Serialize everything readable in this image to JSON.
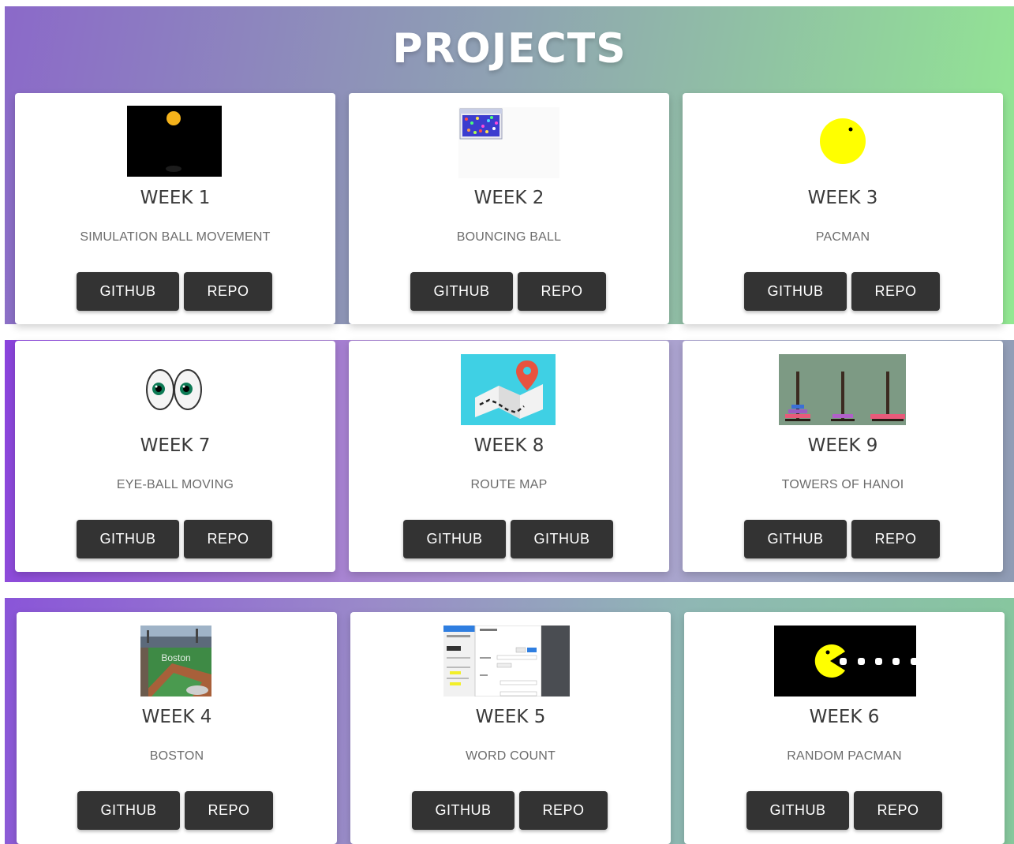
{
  "page": {
    "title": "PROJECTS"
  },
  "cards": [
    {
      "week": "WEEK 1",
      "description": "SIMULATION BALL MOVEMENT",
      "buttons": [
        "GITHUB",
        "REPO"
      ],
      "thumbnail": "ball-simulation-thumbnail"
    },
    {
      "week": "WEEK 2",
      "description": "BOUNCING BALL",
      "buttons": [
        "GITHUB",
        "REPO"
      ],
      "thumbnail": "bouncing-balls-thumbnail"
    },
    {
      "week": "WEEK 3",
      "description": "PACMAN",
      "buttons": [
        "GITHUB",
        "REPO"
      ],
      "thumbnail": "pacman-thumbnail"
    },
    {
      "week": "WEEK 7",
      "description": "EYE-BALL MOVING",
      "buttons": [
        "GITHUB",
        "REPO"
      ],
      "thumbnail": "eyeballs-thumbnail"
    },
    {
      "week": "WEEK 8",
      "description": "ROUTE MAP",
      "buttons": [
        "GITHUB",
        "GITHUB"
      ],
      "thumbnail": "route-map-thumbnail"
    },
    {
      "week": "WEEK 9",
      "description": "TOWERS OF HANOI",
      "buttons": [
        "GITHUB",
        "REPO"
      ],
      "thumbnail": "towers-of-hanoi-thumbnail"
    },
    {
      "week": "WEEK 4",
      "description": "BOSTON",
      "buttons": [
        "GITHUB",
        "REPO"
      ],
      "thumbnail": "boston-stadium-thumbnail",
      "thumbnail_text": "Boston"
    },
    {
      "week": "WEEK 5",
      "description": "WORD COUNT",
      "buttons": [
        "GITHUB",
        "REPO"
      ],
      "thumbnail": "word-count-screenshot-thumbnail"
    },
    {
      "week": "WEEK 6",
      "description": "RANDOM PACMAN",
      "buttons": [
        "GITHUB",
        "REPO"
      ],
      "thumbnail": "random-pacman-thumbnail"
    }
  ],
  "colors": {
    "button_bg": "#333333",
    "button_text": "#ffffff",
    "heading_text": "#3a3a3a",
    "description_text": "#6c6c6c",
    "pacman_yellow": "#ffff00",
    "map_blue": "#3fd0e4",
    "map_pin": "#e8533f",
    "hanoi_bg": "#7d9a84"
  }
}
